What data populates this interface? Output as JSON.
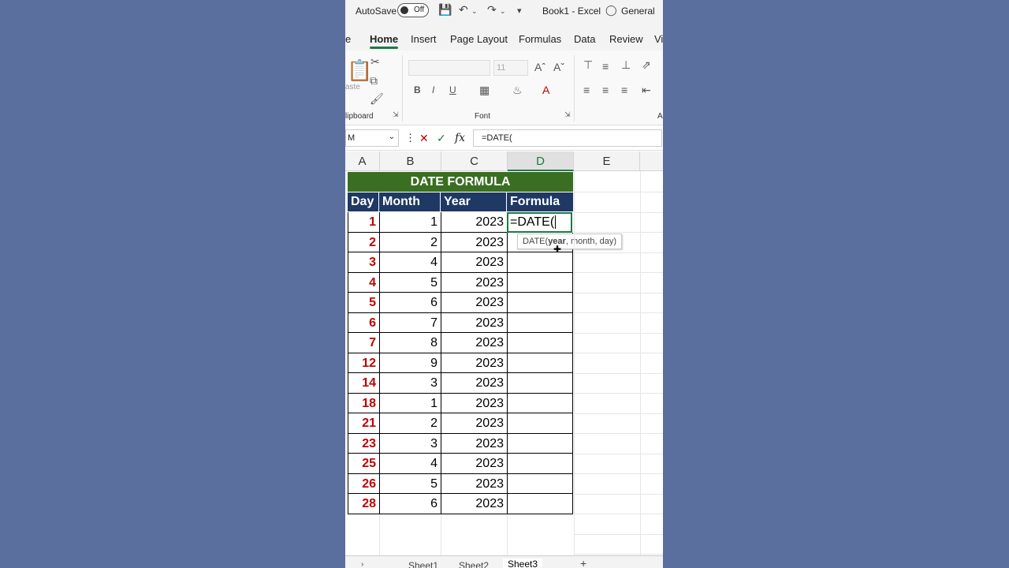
{
  "titlebar": {
    "autosave": "AutoSave",
    "toggle_state": "Off",
    "doc_title": "Book1  -  Excel",
    "sensitivity": "General"
  },
  "tabs": [
    "e",
    "Home",
    "Insert",
    "Page Layout",
    "Formulas",
    "Data",
    "Review",
    "Vi"
  ],
  "ribbon": {
    "paste_label": "aste",
    "clipboard_label": "lipboard",
    "font_label": "Font",
    "font_size": "11",
    "align_label": "A"
  },
  "formula_bar": {
    "name_box": "M",
    "formula": "=DATE("
  },
  "columns": [
    "A",
    "B",
    "C",
    "D",
    "E"
  ],
  "sheet": {
    "banner": "DATE FORMULA",
    "headers": [
      "Day",
      "Month",
      "Year",
      "Formula"
    ],
    "rows": [
      {
        "day": "1",
        "month": "1",
        "year": "2023"
      },
      {
        "day": "2",
        "month": "2",
        "year": "2023"
      },
      {
        "day": "3",
        "month": "4",
        "year": "2023"
      },
      {
        "day": "4",
        "month": "5",
        "year": "2023"
      },
      {
        "day": "5",
        "month": "6",
        "year": "2023"
      },
      {
        "day": "6",
        "month": "7",
        "year": "2023"
      },
      {
        "day": "7",
        "month": "8",
        "year": "2023"
      },
      {
        "day": "12",
        "month": "9",
        "year": "2023"
      },
      {
        "day": "14",
        "month": "3",
        "year": "2023"
      },
      {
        "day": "18",
        "month": "1",
        "year": "2023"
      },
      {
        "day": "21",
        "month": "2",
        "year": "2023"
      },
      {
        "day": "23",
        "month": "3",
        "year": "2023"
      },
      {
        "day": "25",
        "month": "4",
        "year": "2023"
      },
      {
        "day": "26",
        "month": "5",
        "year": "2023"
      },
      {
        "day": "28",
        "month": "6",
        "year": "2023"
      }
    ],
    "active_cell_text": "=DATE(",
    "tooltip": {
      "fn": "DATE(",
      "bold_arg": "year",
      "rest": ", month, day)"
    }
  },
  "sheet_tabs": [
    "Sheet1",
    "Sheet2",
    "Sheet3"
  ],
  "colors": {
    "banner": "#3a6e22",
    "header": "#1f3864",
    "day_text": "#c00000",
    "accent": "#1e7a45"
  }
}
